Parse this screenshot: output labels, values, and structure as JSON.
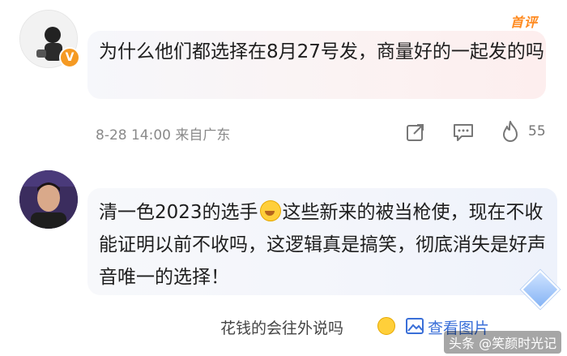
{
  "comments": [
    {
      "badge": "首评",
      "verified_mark": "V",
      "text": "为什么他们都选择在8月27号发，商量好的一起发的吗",
      "time": "8-28 14:00",
      "source": "来自广东",
      "likes": "55"
    },
    {
      "text_before_emoji": "清一色2023的选手",
      "text_after_emoji": "这些新来的被当枪使，现在不收能证明以前不收吗，这逻辑真是搞笑，彻底消失是好声音唯一的选择！"
    }
  ],
  "reply_preview": {
    "text": "花钱的会往外说吗",
    "view_pictures_label": "查看图片"
  },
  "watermark": "头条 @笑颜时光记",
  "icons": {
    "share": "share-icon",
    "comment": "comment-icon",
    "like": "flame-icon",
    "picture": "picture-icon"
  },
  "colors": {
    "badge": "#ff8a1f",
    "verified": "#f59a23",
    "link": "#3a6fd8"
  }
}
